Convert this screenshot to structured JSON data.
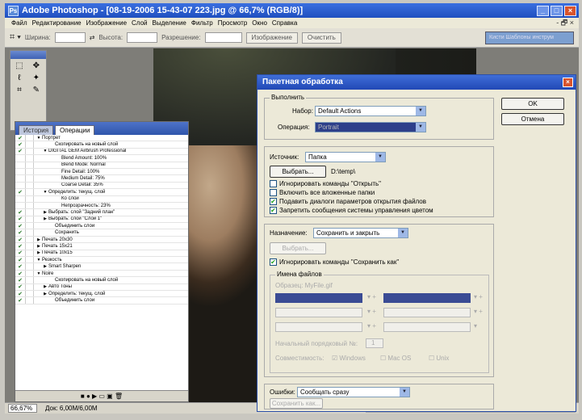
{
  "app": {
    "title": "Adobe Photoshop - [08-19-2006 15-43-07 223.jpg @ 66,7% (RGB/8)]"
  },
  "menubar": {
    "items": [
      "Файл",
      "Редактирование",
      "Изображение",
      "Слой",
      "Выделение",
      "Фильтр",
      "Просмотр",
      "Окно",
      "Справка"
    ],
    "doc_controls": "- 🗗 ×"
  },
  "options_bar": {
    "labels": [
      "Ширина:",
      "Высота:",
      "Разрешение:"
    ],
    "front_image_button": "Изображение",
    "clear_button": "Очистить",
    "brushes_label": "Кисти  Шаблоны инструм"
  },
  "actions_panel": {
    "tabs": [
      "История",
      "Операции"
    ],
    "rows": [
      {
        "level": 0,
        "label": "Портрет",
        "expand": "▼",
        "check": "✔"
      },
      {
        "level": 2,
        "label": "Скопировать на новый слой",
        "expand": "",
        "check": "✔"
      },
      {
        "level": 1,
        "label": "DIGITAL GEM Airbrush Professional",
        "expand": "▼",
        "check": "✔"
      },
      {
        "level": 3,
        "label": "Blend Amount: 100%",
        "expand": "",
        "check": ""
      },
      {
        "level": 3,
        "label": "Blend Mode: Normal",
        "expand": "",
        "check": ""
      },
      {
        "level": 3,
        "label": "Fine Detail: 100%",
        "expand": "",
        "check": ""
      },
      {
        "level": 3,
        "label": "Medium Detail: 75%",
        "expand": "",
        "check": ""
      },
      {
        "level": 3,
        "label": "Coarse Detail: 35%",
        "expand": "",
        "check": ""
      },
      {
        "level": 1,
        "label": "Определить: текущ. слой",
        "expand": "▼",
        "check": "✔"
      },
      {
        "level": 3,
        "label": "Ко слой",
        "expand": "",
        "check": ""
      },
      {
        "level": 3,
        "label": "Непрозрачность: 23%",
        "expand": "",
        "check": ""
      },
      {
        "level": 1,
        "label": "Выбрать: слой \"Задний план\"",
        "expand": "▶",
        "check": "✔"
      },
      {
        "level": 1,
        "label": "Выбрать: слой \"Слой 1\"",
        "expand": "▶",
        "check": "✔"
      },
      {
        "level": 2,
        "label": "Объединить слои",
        "expand": "",
        "check": "✔"
      },
      {
        "level": 2,
        "label": "Сохранить",
        "expand": "",
        "check": "✔"
      },
      {
        "level": 0,
        "label": "Печать 20x30",
        "expand": "▶",
        "check": "✔"
      },
      {
        "level": 0,
        "label": "Печать 15x21",
        "expand": "▶",
        "check": "✔"
      },
      {
        "level": 0,
        "label": "Печать 10x15",
        "expand": "▶",
        "check": "✔"
      },
      {
        "level": 0,
        "label": "Резкость",
        "expand": "▼",
        "check": "✔"
      },
      {
        "level": 1,
        "label": "Smart Sharpen",
        "expand": "▶",
        "check": "✔"
      },
      {
        "level": 0,
        "label": "Noire",
        "expand": "▼",
        "check": "✔"
      },
      {
        "level": 2,
        "label": "Скопировать на новый слой",
        "expand": "",
        "check": "✔"
      },
      {
        "level": 1,
        "label": "Авто Тоны",
        "expand": "▶",
        "check": "✔"
      },
      {
        "level": 1,
        "label": "Определить: текущ. слой",
        "expand": "▶",
        "check": "✔"
      },
      {
        "level": 2,
        "label": "Объединить слои",
        "expand": "",
        "check": "✔"
      }
    ],
    "bottom_icons": "■  ●  ▶  ▭  ▣  🗑"
  },
  "status_bar": {
    "zoom": "66,67%",
    "doc_info": "Док: 6,00M/6,00M"
  },
  "batch_dialog": {
    "title": "Пакетная обработка",
    "ok": "OK",
    "cancel": "Отмена",
    "play": {
      "legend": "Выполнить",
      "set_label": "Набор:",
      "set_value": "Default Actions",
      "action_label": "Операция:",
      "action_value": "Portrait"
    },
    "source": {
      "label": "Источник:",
      "value": "Папка",
      "choose_button": "Выбрать...",
      "path": "D:\\temp\\",
      "checkboxes": [
        {
          "label": "Игнорировать команды \"Открыть\"",
          "checked": false
        },
        {
          "label": "Включить все вложенные папки",
          "checked": false
        },
        {
          "label": "Подавить диалоги параметров открытия файлов",
          "checked": true
        },
        {
          "label": "Запретить сообщения системы управления цветом",
          "checked": true
        }
      ]
    },
    "destination": {
      "label": "Назначение:",
      "value": "Сохранить и закрыть",
      "choose_button": "Выбрать...",
      "override_label": "Игнорировать команды \"Сохранить как\"",
      "override_checked": true,
      "file_naming_legend": "Имена файлов",
      "example_label": "Образец: MyFile.gif",
      "start_serial_label": "Начальный порядковый №:",
      "start_serial_value": "1",
      "compat_label": "Совместимость:",
      "compat_options": [
        "Windows",
        "Mac OS",
        "Unix"
      ]
    },
    "errors": {
      "label": "Ошибки:",
      "value": "Сообщать сразу",
      "save_as_button": "Сохранить как..."
    }
  }
}
